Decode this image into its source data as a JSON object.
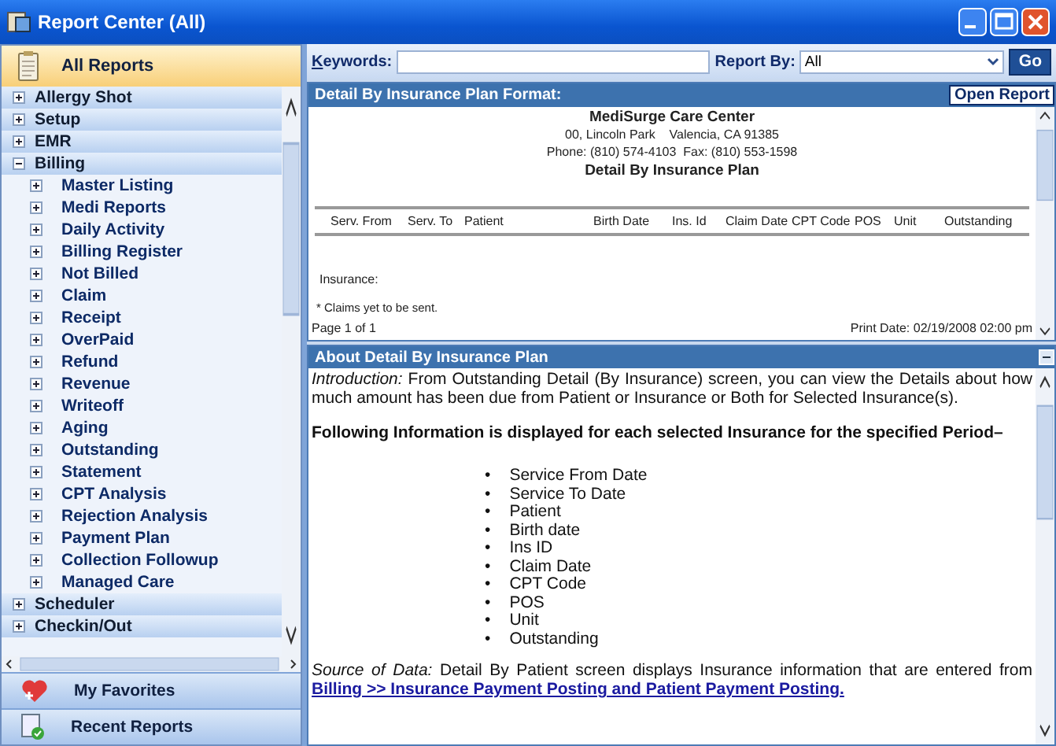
{
  "window": {
    "title": "Report Center (All)"
  },
  "sidebar": {
    "header": "All Reports",
    "tree": [
      {
        "label": "Allergy Shot",
        "expanded": false
      },
      {
        "label": "Setup",
        "expanded": false
      },
      {
        "label": "EMR",
        "expanded": false
      },
      {
        "label": "Billing",
        "expanded": true,
        "children": [
          {
            "label": "Master Listing",
            "expanded": false
          },
          {
            "label": "Medi Reports",
            "expanded": false
          },
          {
            "label": "Daily Activity",
            "expanded": false
          },
          {
            "label": "Billing Register",
            "expanded": false
          },
          {
            "label": "Not Billed",
            "expanded": false
          },
          {
            "label": "Claim",
            "expanded": false
          },
          {
            "label": "Receipt",
            "expanded": false
          },
          {
            "label": "OverPaid",
            "expanded": false
          },
          {
            "label": "Refund",
            "expanded": false
          },
          {
            "label": "Revenue",
            "expanded": false
          },
          {
            "label": "Writeoff",
            "expanded": false
          },
          {
            "label": "Aging",
            "expanded": false
          },
          {
            "label": "Outstanding",
            "expanded": false
          },
          {
            "label": "Statement",
            "expanded": false
          },
          {
            "label": "CPT Analysis",
            "expanded": false
          },
          {
            "label": "Rejection Analysis",
            "expanded": false
          },
          {
            "label": "Payment Plan",
            "expanded": false
          },
          {
            "label": "Collection Followup",
            "expanded": false
          },
          {
            "label": "Managed Care",
            "expanded": false
          }
        ]
      },
      {
        "label": "Scheduler",
        "expanded": false
      },
      {
        "label": "Checkin/Out",
        "expanded": false
      }
    ],
    "footer_buttons": [
      {
        "kind": "favorites",
        "label": "My Favorites"
      },
      {
        "kind": "recent",
        "label": "Recent Reports"
      }
    ]
  },
  "toolbar": {
    "keywords_label": "Keywords:",
    "report_by_label": "Report By:",
    "report_by_value": "All",
    "go_button": "Go"
  },
  "format_panel": {
    "title": "Detail By Insurance Plan Format:",
    "open_button": "Open Report",
    "report": {
      "company": "MediSurge Care Center",
      "address": "00, Lincoln Park    Valencia, CA 91385",
      "phone": "Phone: (810) 574-4103  Fax: (810) 553-1598",
      "title": "Detail By Insurance Plan",
      "columns": [
        "Serv. From",
        "Serv. To",
        "Patient",
        "Birth Date",
        "Ins. Id",
        "Claim Date",
        "CPT Code",
        "POS",
        "Unit",
        "Outstanding"
      ],
      "insurance_label": "Insurance:",
      "note": "* Claims yet to be sent.",
      "page": "Page 1 of 1",
      "print_date": "Print Date: 02/19/2008 02:00 pm"
    }
  },
  "about_panel": {
    "title": "About Detail By Insurance Plan",
    "intro": "*Introduction:* From Outstanding Detail (By Insurance) screen, you can view the Details about how much amount has been due from Patient or Insurance or Both for Selected Insurance(s).",
    "following": "Following Information is displayed for each selected Insurance for the specified Period–",
    "bullet": "•",
    "items": [
      "Service From Date",
      "Service To Date",
      "Patient",
      "Birth date",
      "Ins ID",
      "Claim Date",
      "CPT Code",
      "POS",
      "Unit",
      "Outstanding"
    ],
    "source": "*Source of Data:* Detail By Patient screen displays Insurance information that are entered from",
    "source_link": "Billing >> Insurance Payment Posting and Patient Payment Posting."
  }
}
